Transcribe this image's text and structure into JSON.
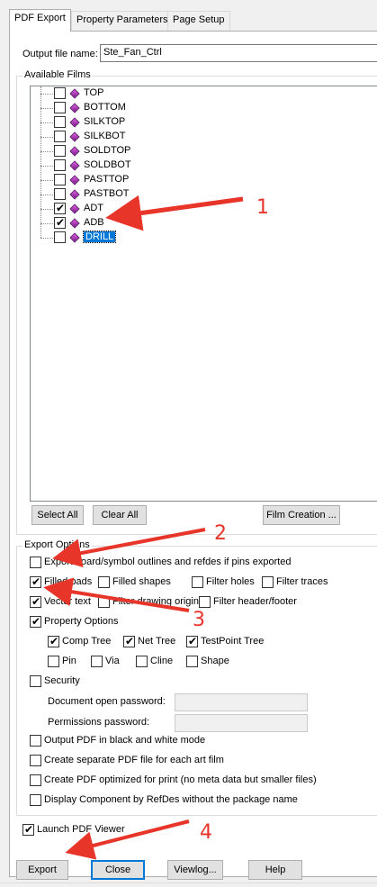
{
  "tabs": [
    "PDF Export",
    "Property Parameters",
    "Page Setup"
  ],
  "output": {
    "label": "Output file name:",
    "value": "Ste_Fan_Ctrl"
  },
  "films_group_label": "Available Films",
  "films": [
    {
      "name": "TOP",
      "checked": false
    },
    {
      "name": "BOTTOM",
      "checked": false
    },
    {
      "name": "SILKTOP",
      "checked": false
    },
    {
      "name": "SILKBOT",
      "checked": false
    },
    {
      "name": "SOLDTOP",
      "checked": false
    },
    {
      "name": "SOLDBOT",
      "checked": false
    },
    {
      "name": "PASTTOP",
      "checked": false
    },
    {
      "name": "PASTBOT",
      "checked": false
    },
    {
      "name": "ADT",
      "checked": true
    },
    {
      "name": "ADB",
      "checked": true
    },
    {
      "name": "DRILL",
      "checked": false,
      "selected": true
    }
  ],
  "film_buttons": {
    "select_all": "Select All",
    "clear_all": "Clear All",
    "film_creation": "Film Creation ..."
  },
  "export_options": {
    "label": "Export Options",
    "export_outlines": {
      "label": "Export board/symbol outlines and refdes if pins exported",
      "checked": false
    },
    "filled_pads": {
      "label": "Filled pads",
      "checked": true
    },
    "filled_shapes": {
      "label": "Filled shapes",
      "checked": false
    },
    "filter_holes": {
      "label": "Filter holes",
      "checked": false
    },
    "filter_traces": {
      "label": "Filter traces",
      "checked": false
    },
    "vector_text": {
      "label": "Vector text",
      "checked": true
    },
    "filter_drawing_origin": {
      "label": "Filter drawing origin",
      "checked": false
    },
    "filter_header_footer": {
      "label": "Filter header/footer",
      "checked": false
    },
    "property_options": {
      "label": "Property Options",
      "checked": true
    },
    "comp_tree": {
      "label": "Comp Tree",
      "checked": true
    },
    "net_tree": {
      "label": "Net Tree",
      "checked": true
    },
    "testpoint_tree": {
      "label": "TestPoint Tree",
      "checked": true
    },
    "pin": {
      "label": "Pin",
      "checked": false
    },
    "via": {
      "label": "Via",
      "checked": false
    },
    "cline": {
      "label": "Cline",
      "checked": false
    },
    "shape": {
      "label": "Shape",
      "checked": false
    },
    "security": {
      "label": "Security",
      "checked": false
    },
    "doc_open_password": {
      "label": "Document open password:",
      "value": ""
    },
    "permissions_password": {
      "label": "Permissions password:",
      "value": ""
    },
    "black_white": {
      "label": "Output PDF in black and white mode",
      "checked": false
    },
    "separate_pdf": {
      "label": "Create separate PDF file for each art film",
      "checked": false
    },
    "optimized_print": {
      "label": "Create PDF optimized for print (no meta data but smaller files)",
      "checked": false
    },
    "display_refdes": {
      "label": "Display Component by RefDes without the package name",
      "checked": false
    }
  },
  "launch_viewer": {
    "label": "Launch PDF Viewer",
    "checked": true
  },
  "buttons": {
    "export": "Export",
    "close": "Close",
    "viewlog": "Viewlog...",
    "help": "Help"
  },
  "annotations": [
    "1",
    "2",
    "3",
    "4"
  ],
  "colors": {
    "annotation": "#e8352a",
    "selection": "#0078d7"
  }
}
